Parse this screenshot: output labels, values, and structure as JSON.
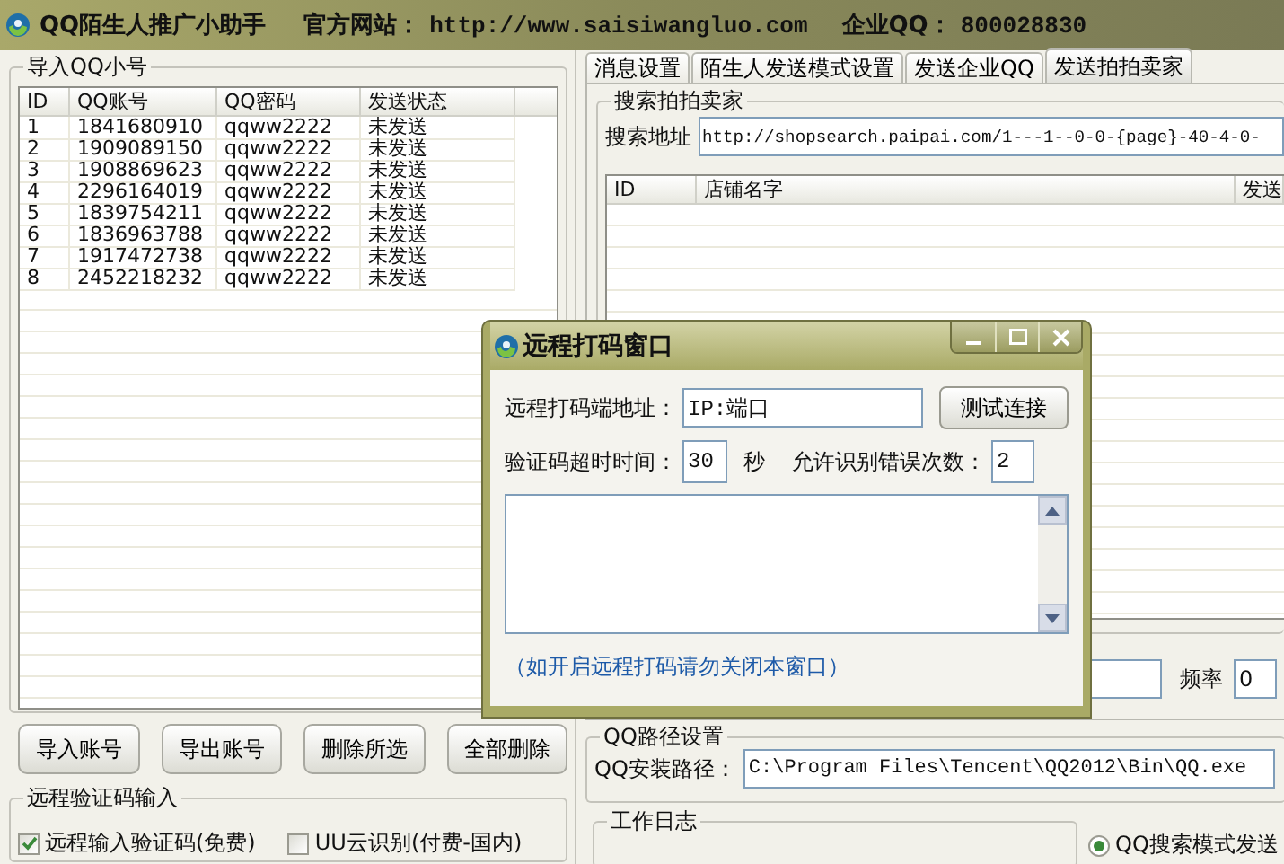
{
  "window": {
    "title": "QQ陌生人推广小助手",
    "website_label": "官方网站：",
    "website": "http://www.saisiwangluo.com",
    "qq_label": "企业QQ：",
    "qq": "800028830"
  },
  "accounts": {
    "title": "导入QQ小号",
    "columns": [
      "ID",
      "QQ账号",
      "QQ密码",
      "发送状态"
    ],
    "rows": [
      [
        "1",
        "1841680910",
        "qqww2222",
        "未发送"
      ],
      [
        "2",
        "1909089150",
        "qqww2222",
        "未发送"
      ],
      [
        "3",
        "1908869623",
        "qqww2222",
        "未发送"
      ],
      [
        "4",
        "2296164019",
        "qqww2222",
        "未发送"
      ],
      [
        "5",
        "1839754211",
        "qqww2222",
        "未发送"
      ],
      [
        "6",
        "1836963788",
        "qqww2222",
        "未发送"
      ],
      [
        "7",
        "1917472738",
        "qqww2222",
        "未发送"
      ],
      [
        "8",
        "2452218232",
        "qqww2222",
        "未发送"
      ]
    ]
  },
  "account_buttons": [
    "导入账号",
    "导出账号",
    "删除所选",
    "全部删除"
  ],
  "captcha": {
    "title": "远程验证码输入",
    "options": [
      {
        "label": "远程输入验证码(免费)",
        "checked": true
      },
      {
        "label": "UU云识别(付费-国内)",
        "checked": false
      }
    ]
  },
  "tabs": [
    {
      "label": "消息设置",
      "selected": false
    },
    {
      "label": "陌生人发送模式设置",
      "selected": false
    },
    {
      "label": "发送企业QQ",
      "selected": false
    },
    {
      "label": "发送拍拍卖家",
      "selected": true
    }
  ],
  "seller_search": {
    "title": "搜索拍拍卖家",
    "address_label": "搜索地址",
    "address": "http://shopsearch.paipai.com/1---1--0-0-{page}-40-4-0-",
    "columns": [
      "ID",
      "店铺名字",
      "发送"
    ]
  },
  "frequency": {
    "label": "频率",
    "value": "0"
  },
  "qq_path": {
    "title": "QQ路径设置",
    "label": "QQ安装路径：",
    "value": "C:\\Program Files\\Tencent\\QQ2012\\Bin\\QQ.exe"
  },
  "work_log": {
    "title": "工作日志"
  },
  "send_modes": [
    {
      "label": "QQ搜索模式发送",
      "selected": true
    }
  ],
  "dialog": {
    "title": "远程打码窗口",
    "address_label": "远程打码端地址：",
    "address": "IP:端口",
    "test_button": "测试连接",
    "timeout_label": "验证码超时时间：",
    "timeout": "30",
    "unit": "秒",
    "retries_label": "允许识别错误次数：",
    "retries": "2",
    "note": "（如开启远程打码请勿关闭本窗口）"
  }
}
